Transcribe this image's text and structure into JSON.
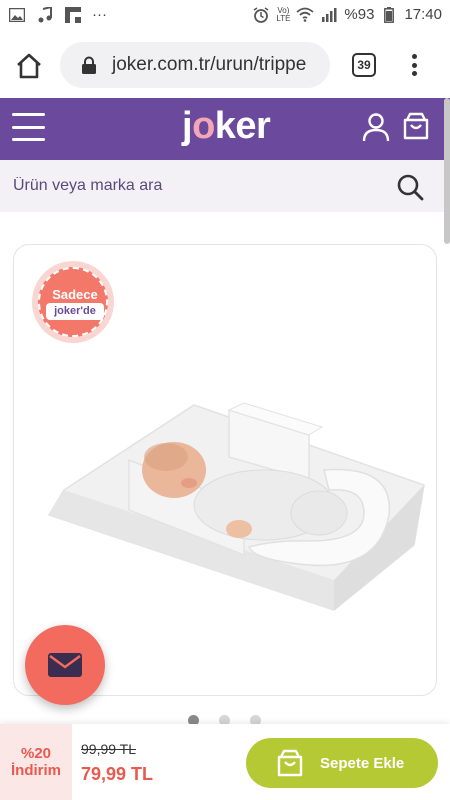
{
  "status_bar": {
    "volte_line1": "Vo)",
    "volte_line2": "LTE",
    "battery": "%93",
    "time": "17:40",
    "notification_dots": "···",
    "signal_label": "4G"
  },
  "browser": {
    "url": "joker.com.tr/urun/trippe",
    "tab_count": "39"
  },
  "header": {
    "logo_j": "j",
    "logo_o": "o",
    "logo_rest": "ker"
  },
  "search": {
    "placeholder": "Ürün veya marka ara"
  },
  "product": {
    "badge_top": "Sadece",
    "badge_bottom": "joker'de",
    "image_icon": "baby-sleep-positioner-image",
    "carousel_dots": 3,
    "active_dot": 0
  },
  "purchase": {
    "discount_line1": "%20",
    "discount_line2": "İndirim",
    "old_price": "99,99 TL",
    "new_price": "79,99 TL",
    "add_to_cart": "Sepete Ekle"
  },
  "colors": {
    "brand_purple": "#6b4a9d",
    "accent_coral": "#f26b5e",
    "cta_green": "#b5c935"
  }
}
